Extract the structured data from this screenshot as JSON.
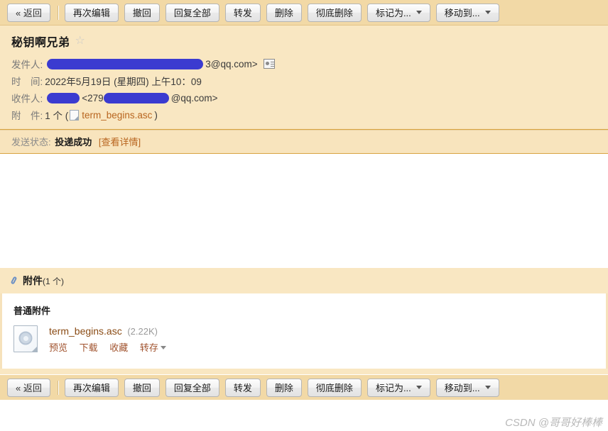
{
  "toolbar": {
    "back_label": "« 返回",
    "buttons": [
      {
        "label": "再次编辑",
        "dropdown": false
      },
      {
        "label": "撤回",
        "dropdown": false
      },
      {
        "label": "回复全部",
        "dropdown": false
      },
      {
        "label": "转发",
        "dropdown": false
      },
      {
        "label": "删除",
        "dropdown": false
      },
      {
        "label": "彻底删除",
        "dropdown": false
      },
      {
        "label": "标记为...",
        "dropdown": true
      },
      {
        "label": "移动到...",
        "dropdown": true
      }
    ]
  },
  "mail": {
    "subject": "秘钥啊兄弟",
    "star_icon": "star-outline-icon",
    "sender": {
      "label": "发件人:",
      "redacted_prefix": true,
      "value_visible": "3@qq.com>",
      "contact_icon": "contact-card-icon"
    },
    "date": {
      "label": "时　间:",
      "value": "2022年5月19日 (星期四) 上午10：09"
    },
    "recipient": {
      "label": "收件人:",
      "value_mid": "<279",
      "value_tail": "@qq.com>"
    },
    "attachment_line": {
      "label": "附　件:",
      "count_text": "1 个 (",
      "file_name": "term_begins.asc",
      "close_paren": ")"
    },
    "status": {
      "label": "发送状态:",
      "value": "投递成功",
      "detail_link": "[查看详情]"
    }
  },
  "attachments_panel": {
    "title": "附件",
    "count": "(1 个)",
    "group_title": "普通附件",
    "items": [
      {
        "name": "term_begins.asc",
        "size": "(2.22K)",
        "actions": [
          "预览",
          "下载",
          "收藏",
          "转存"
        ],
        "last_action_has_caret": true
      }
    ]
  },
  "watermark": "CSDN @哥哥好棒棒",
  "colors": {
    "toolbar_bg": "#f2d9a6",
    "header_bg": "#f9e7c2",
    "header_border": "#d9a441",
    "link": "#a0522d",
    "redact": "#3b3bd0",
    "status_value": "#1a1a1a"
  }
}
